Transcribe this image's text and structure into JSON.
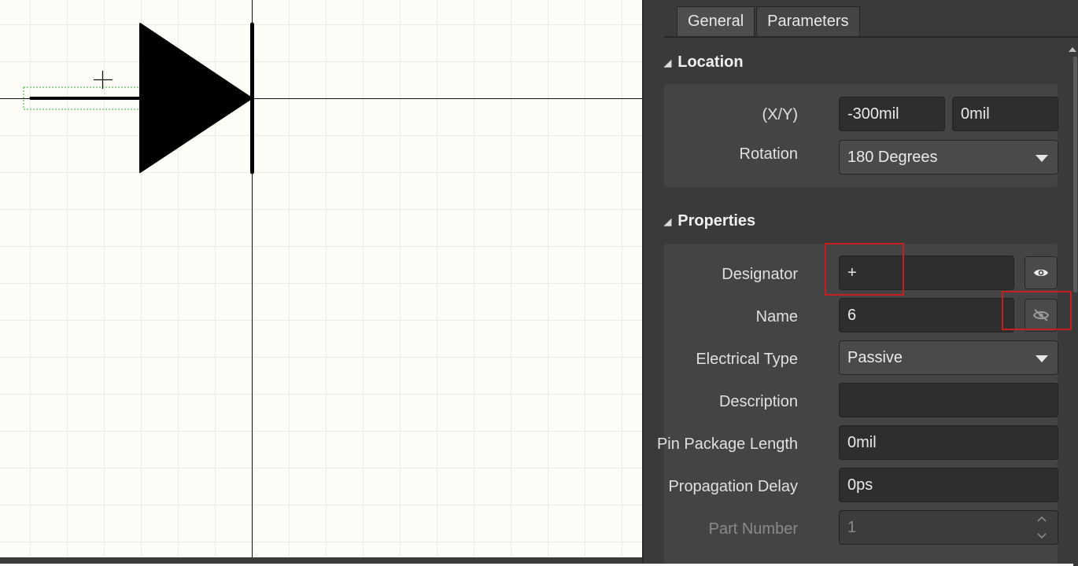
{
  "canvas": {
    "cursor_symbol": "+",
    "grid": true
  },
  "panel": {
    "tabs": [
      {
        "label": "General",
        "active": true
      },
      {
        "label": "Parameters",
        "active": false
      }
    ],
    "location": {
      "header": "Location",
      "xy_label": "(X/Y)",
      "x_value": "-300mil",
      "y_value": "0mil",
      "rotation_label": "Rotation",
      "rotation_value": "180 Degrees"
    },
    "properties": {
      "header": "Properties",
      "designator_label": "Designator",
      "designator_value": "+",
      "name_label": "Name",
      "name_value": "6",
      "electrical_type_label": "Electrical Type",
      "electrical_type_value": "Passive",
      "description_label": "Description",
      "description_value": "",
      "pin_package_length_label": "Pin Package Length",
      "pin_package_length_value": "0mil",
      "propagation_delay_label": "Propagation Delay",
      "propagation_delay_value": "0ps",
      "part_number_label": "Part Number",
      "part_number_value": "1"
    }
  },
  "colors": {
    "panel_bg": "#3a3a3a",
    "canvas_bg": "#fdfcf7",
    "highlight": "#c81e1e"
  },
  "icons": {
    "designator_visibility": "eye-icon",
    "name_visibility": "eye-off-icon"
  }
}
